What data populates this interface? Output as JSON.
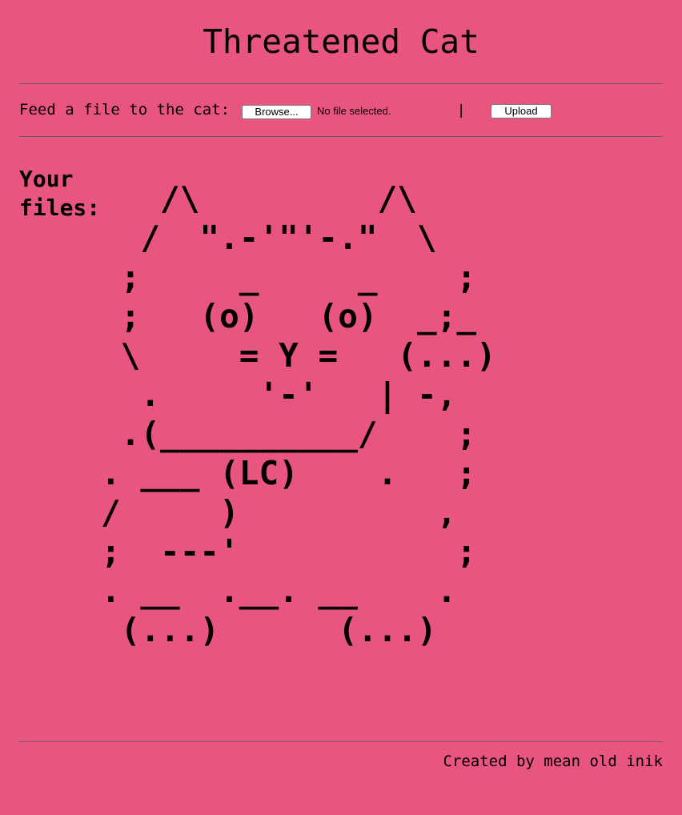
{
  "page": {
    "title": "Threatened Cat",
    "background_color": "#e8557f"
  },
  "upload": {
    "label": "Feed a file to the cat:",
    "browse_label": "Browse...",
    "file_status": "No file selected.",
    "cursor_glyph": "|",
    "upload_label": "Upload"
  },
  "files": {
    "heading": "Your files:",
    "ascii_cat": "   /\\         /\\\n  /  \".-'\"'-.\"  \\\n ;     _     _    ;\n ;   (o)   (o)  _;_\n \\     = Y =   (...)\n  .     '-'   | -,\n .(__________/    ;\n. ___ (LC)    .   ;\n/     )          ,\n;  ---'           ;\n. __  .__. __    .\n (...)      (...)"
  },
  "footer": {
    "text": "Created by mean old inik"
  }
}
